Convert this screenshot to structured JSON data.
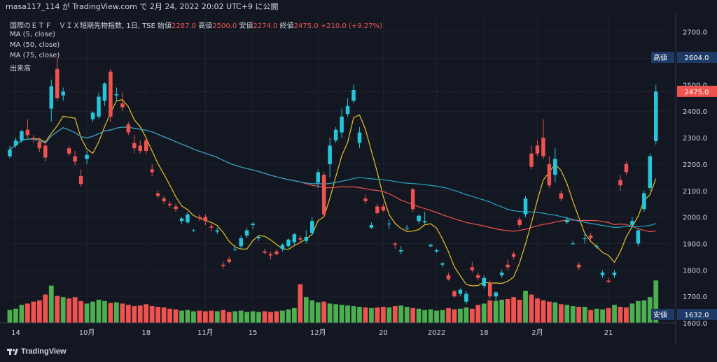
{
  "header": {
    "publish_line": "masa117_114 が TradingView.com で 2月 24, 2022 20:02 UTC+9 に公開"
  },
  "legend": {
    "symbol": "国際のＥＴＦ　ＶＩＸ短期先物指数, 1日, TSE",
    "open_label": "始値",
    "open": "2287.0",
    "high_label": "高値",
    "high": "2500.0",
    "low_label": "安値",
    "low": "2274.0",
    "close_label": "終値",
    "close": "2475.0",
    "change": "+210.0 (+9.27%)",
    "ma5": "MA (5, close)",
    "ma50": "MA (50, close)",
    "ma75": "MA (75, close)",
    "volume": "出来高"
  },
  "footer": {
    "brand": "TradingView"
  },
  "colors": {
    "up": "#26c6da",
    "down": "#ef5350",
    "vol_up": "#4caf50",
    "vol_down": "#ef5350",
    "ma5": "#e6c229",
    "ma50": "#ef5350",
    "ma75": "#26a6c4",
    "bg": "#131722"
  },
  "chart_data": {
    "type": "candlestick",
    "y_ticks": [
      "2700.0",
      "2600.0",
      "2500.0",
      "2400.0",
      "2300.0",
      "2200.0",
      "2100.0",
      "2000.0",
      "1900.0",
      "1800.0",
      "1700.0",
      "1600.0"
    ],
    "ylim": [
      1600,
      2760
    ],
    "x_ticks": [
      {
        "label": "14",
        "i": 1
      },
      {
        "label": "10月",
        "i": 13
      },
      {
        "label": "18",
        "i": 23
      },
      {
        "label": "11月",
        "i": 33
      },
      {
        "label": "15",
        "i": 41
      },
      {
        "label": "12月",
        "i": 52
      },
      {
        "label": "20",
        "i": 63
      },
      {
        "label": "2022",
        "i": 72
      },
      {
        "label": "18",
        "i": 80
      },
      {
        "label": "2月",
        "i": 89
      },
      {
        "label": "21",
        "i": 101
      }
    ],
    "price_labels": [
      {
        "label": "高値",
        "value": "2604.0",
        "price": 2604,
        "color": "#1e3a66"
      },
      {
        "label": "",
        "value": "2475.0",
        "price": 2475,
        "color": "#ef5350"
      },
      {
        "label": "安値",
        "value": "1632.0",
        "price": 1632,
        "color": "#1e3a66"
      }
    ],
    "candles": [
      [
        2230,
        2270,
        2222,
        2255
      ],
      [
        2270,
        2300,
        2262,
        2290
      ],
      [
        2290,
        2330,
        2280,
        2325
      ],
      [
        2330,
        2370,
        2300,
        2310
      ],
      [
        2300,
        2310,
        2280,
        2295
      ],
      [
        2285,
        2300,
        2245,
        2260
      ],
      [
        2270,
        2290,
        2210,
        2225
      ],
      [
        2410,
        2520,
        2360,
        2495
      ],
      [
        2560,
        2600,
        2440,
        2450
      ],
      [
        2460,
        2490,
        2440,
        2475
      ],
      [
        2260,
        2270,
        2230,
        2240
      ],
      [
        2230,
        2250,
        2195,
        2210
      ],
      [
        2155,
        2180,
        2115,
        2125
      ],
      [
        2220,
        2250,
        2200,
        2235
      ],
      [
        2370,
        2400,
        2360,
        2395
      ],
      [
        2380,
        2470,
        2370,
        2455
      ],
      [
        2440,
        2510,
        2420,
        2505
      ],
      [
        2550,
        2560,
        2360,
        2380
      ],
      [
        2460,
        2490,
        2440,
        2465
      ],
      [
        2430,
        2470,
        2400,
        2415
      ],
      [
        2350,
        2360,
        2310,
        2320
      ],
      [
        2280,
        2310,
        2240,
        2260
      ],
      [
        2270,
        2290,
        2240,
        2250
      ],
      [
        2290,
        2300,
        2240,
        2250
      ],
      [
        2180,
        2200,
        2155,
        2170
      ],
      [
        2090,
        2100,
        2070,
        2080
      ],
      [
        2070,
        2080,
        2050,
        2060
      ],
      [
        2050,
        2060,
        2035,
        2045
      ],
      [
        2040,
        2050,
        2020,
        2030
      ],
      [
        1985,
        2000,
        1975,
        1995
      ],
      [
        1980,
        2020,
        1975,
        2010
      ],
      [
        1950,
        1955,
        1945,
        1950
      ],
      [
        2000,
        2010,
        1985,
        1995
      ],
      [
        2000,
        2010,
        1970,
        1985
      ],
      [
        1965,
        1975,
        1945,
        1960
      ],
      [
        1945,
        1960,
        1935,
        1950
      ],
      [
        1820,
        1830,
        1805,
        1815
      ],
      [
        1840,
        1850,
        1825,
        1830
      ],
      [
        1880,
        1895,
        1870,
        1880
      ],
      [
        1890,
        1930,
        1880,
        1920
      ],
      [
        1930,
        1960,
        1920,
        1950
      ],
      [
        1970,
        1980,
        1955,
        1975
      ],
      [
        1920,
        1930,
        1910,
        1925
      ],
      [
        1870,
        1880,
        1860,
        1865
      ],
      [
        1860,
        1870,
        1840,
        1855
      ],
      [
        1870,
        1880,
        1855,
        1860
      ],
      [
        1880,
        1900,
        1870,
        1895
      ],
      [
        1890,
        1920,
        1885,
        1915
      ],
      [
        1905,
        1940,
        1895,
        1935
      ],
      [
        1920,
        1930,
        1900,
        1915
      ],
      [
        1910,
        1950,
        1900,
        1925
      ],
      [
        1940,
        2000,
        1930,
        1985
      ],
      [
        2130,
        2180,
        2110,
        2170
      ],
      [
        2160,
        2170,
        2000,
        2010
      ],
      [
        2200,
        2300,
        2150,
        2270
      ],
      [
        2290,
        2340,
        2280,
        2330
      ],
      [
        2320,
        2410,
        2300,
        2380
      ],
      [
        2390,
        2450,
        2380,
        2420
      ],
      [
        2440,
        2500,
        2430,
        2480
      ],
      [
        2280,
        2340,
        2260,
        2320
      ],
      [
        2070,
        2085,
        2050,
        2060
      ],
      [
        1960,
        1980,
        1955,
        1970
      ],
      [
        2040,
        2050,
        2010,
        2015
      ],
      [
        2040,
        2050,
        2020,
        2025
      ],
      [
        1975,
        1990,
        1955,
        1975
      ],
      [
        1900,
        1905,
        1880,
        1895
      ],
      [
        1870,
        1890,
        1860,
        1875
      ],
      [
        1960,
        1970,
        1950,
        1960
      ],
      [
        2105,
        2110,
        2020,
        2030
      ],
      [
        1985,
        2010,
        1975,
        2005
      ],
      [
        1980,
        2020,
        1975,
        1985
      ],
      [
        1890,
        1900,
        1885,
        1895
      ],
      [
        1870,
        1880,
        1865,
        1875
      ],
      [
        1820,
        1830,
        1810,
        1825
      ],
      [
        1780,
        1790,
        1760,
        1765
      ],
      [
        1720,
        1725,
        1695,
        1700
      ],
      [
        1710,
        1730,
        1700,
        1725
      ],
      [
        1680,
        1720,
        1670,
        1710
      ],
      [
        1810,
        1830,
        1790,
        1800
      ],
      [
        1780,
        1790,
        1760,
        1770
      ],
      [
        1740,
        1780,
        1730,
        1770
      ],
      [
        1750,
        1760,
        1690,
        1700
      ],
      [
        1700,
        1720,
        1680,
        1715
      ],
      [
        1780,
        1800,
        1770,
        1790
      ],
      [
        1820,
        1840,
        1800,
        1810
      ],
      [
        1860,
        1870,
        1840,
        1850
      ],
      [
        1990,
        2000,
        1960,
        1970
      ],
      [
        2010,
        2080,
        2000,
        2070
      ],
      [
        2240,
        2270,
        2180,
        2190
      ],
      [
        2270,
        2290,
        2230,
        2240
      ],
      [
        2300,
        2370,
        2220,
        2230
      ],
      [
        2200,
        2230,
        2110,
        2120
      ],
      [
        2160,
        2260,
        2130,
        2220
      ],
      [
        2090,
        2100,
        2060,
        2070
      ],
      [
        1980,
        2000,
        1975,
        1990
      ],
      [
        1900,
        1910,
        1895,
        1900
      ],
      [
        1820,
        1830,
        1800,
        1810
      ],
      [
        1920,
        1940,
        1900,
        1920
      ],
      [
        1930,
        1940,
        1910,
        1920
      ],
      [
        1890,
        1900,
        1880,
        1890
      ],
      [
        1780,
        1800,
        1770,
        1790
      ],
      [
        1760,
        1770,
        1750,
        1755
      ],
      [
        1780,
        1800,
        1770,
        1790
      ],
      [
        2140,
        2160,
        2100,
        2120
      ],
      [
        2200,
        2210,
        2160,
        2170
      ],
      [
        1970,
        2000,
        1960,
        1985
      ],
      [
        1900,
        1960,
        1890,
        1950
      ],
      [
        2030,
        2100,
        2020,
        2090
      ],
      [
        2110,
        2240,
        2100,
        2230
      ],
      [
        2287,
        2500,
        2274,
        2475
      ]
    ],
    "volume_max": 100,
    "volumes": [
      20,
      22,
      28,
      30,
      33,
      35,
      44,
      58,
      42,
      40,
      38,
      40,
      34,
      30,
      33,
      36,
      34,
      31,
      32,
      30,
      28,
      26,
      27,
      29,
      26,
      25,
      24,
      22,
      21,
      19,
      20,
      18,
      19,
      18,
      19,
      18,
      20,
      17,
      18,
      19,
      17,
      18,
      17,
      18,
      17,
      18,
      19,
      21,
      23,
      60,
      40,
      35,
      32,
      33,
      30,
      29,
      28,
      27,
      26,
      25,
      24,
      23,
      24,
      25,
      24,
      26,
      27,
      25,
      23,
      22,
      20,
      21,
      19,
      20,
      23,
      21,
      22,
      24,
      22,
      28,
      30,
      35,
      34,
      36,
      37,
      40,
      36,
      50,
      44,
      38,
      35,
      33,
      32,
      29,
      28,
      26,
      25,
      25,
      20,
      22,
      21,
      23,
      28,
      25,
      24,
      30,
      34,
      35,
      40,
      66
    ]
  }
}
